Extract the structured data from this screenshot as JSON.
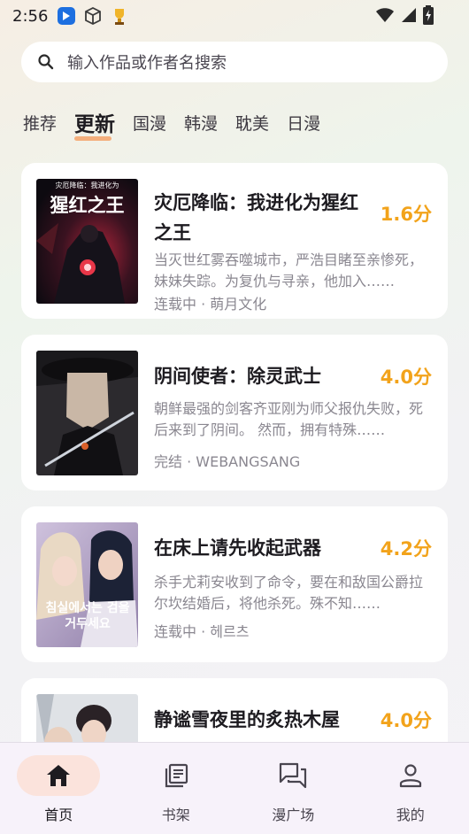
{
  "status_bar": {
    "time": "2:56"
  },
  "search": {
    "placeholder": "输入作品或作者名搜索"
  },
  "tabs": [
    {
      "label": "推荐"
    },
    {
      "label": "更新"
    },
    {
      "label": "国漫"
    },
    {
      "label": "韩漫"
    },
    {
      "label": "耽美"
    },
    {
      "label": "日漫"
    }
  ],
  "active_tab": "更新",
  "comics": [
    {
      "title": "灾厄降临：我进化为猩红之王",
      "score": "1.6分",
      "description": "当灭世红雾吞噬城市，严浩目睹至亲惨死，妹妹失踪。为复仇与寻亲，他加入……",
      "meta": "连载中 · 萌月文化",
      "cover_text": "猩红之王",
      "cover_subtitle": "灾厄降临：我进化为"
    },
    {
      "title": "阴间使者：除灵武士",
      "score": "4.0分",
      "description": "朝鲜最强的剑客齐亚刚为师父报仇失败，死后来到了阴间。 然而，拥有特殊……",
      "meta": "完结 · WEBANGSANG"
    },
    {
      "title": "在床上请先收起武器",
      "score": "4.2分",
      "description": "杀手尤莉安收到了命令，要在和敌国公爵拉尔坎结婚后，将他杀死。殊不知……",
      "meta": "连载中 · 헤르츠",
      "cover_text": "침실에서는 검을 거두세요"
    },
    {
      "title": "静谧雪夜里的炙热木屋",
      "score": "4.0分"
    }
  ],
  "bottom_nav": [
    {
      "label": "首页",
      "icon": "home-icon"
    },
    {
      "label": "书架",
      "icon": "bookshelf-icon"
    },
    {
      "label": "漫广场",
      "icon": "forum-icon"
    },
    {
      "label": "我的",
      "icon": "person-icon"
    }
  ],
  "colors": {
    "score": "#f2a31b",
    "active_nav": "#fbe3dc",
    "tab_underline": "#f5a36a"
  }
}
